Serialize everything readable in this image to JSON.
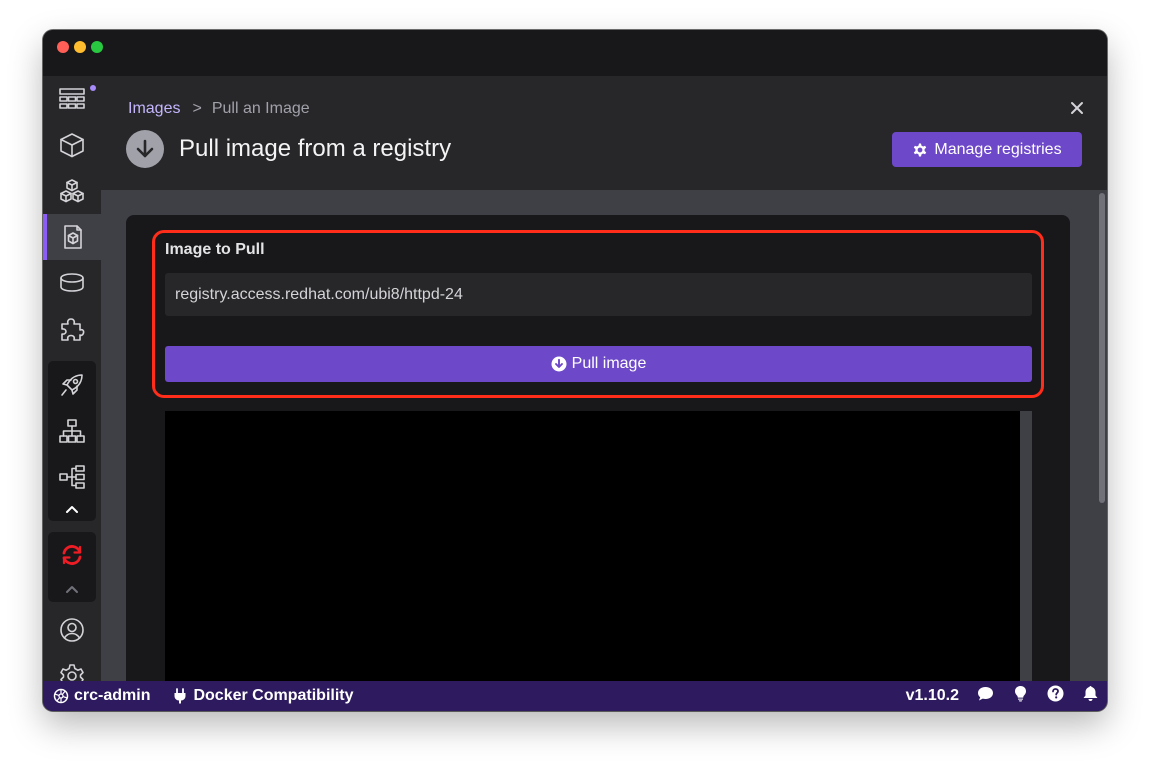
{
  "breadcrumb": {
    "parent": "Images",
    "separator": ">",
    "current": "Pull an Image"
  },
  "header": {
    "title": "Pull image from a registry",
    "manage_label": "Manage registries"
  },
  "form": {
    "section_label": "Image to Pull",
    "image_value": "registry.access.redhat.com/ubi8/httpd-24",
    "pull_label": "Pull image"
  },
  "sidebar": {
    "items": [
      {
        "name": "dashboard",
        "icon": "dashboard-icon",
        "badge": true
      },
      {
        "name": "containers",
        "icon": "cube-icon"
      },
      {
        "name": "pods",
        "icon": "cubes-icon"
      },
      {
        "name": "images",
        "icon": "image-layers-icon",
        "active": true
      },
      {
        "name": "volumes",
        "icon": "database-icon"
      },
      {
        "name": "extensions",
        "icon": "puzzle-icon"
      },
      {
        "name": "deployments",
        "icon": "rocket-icon"
      },
      {
        "name": "services",
        "icon": "sitemap-icon"
      },
      {
        "name": "ingresses",
        "icon": "tree-icon"
      }
    ]
  },
  "statusbar": {
    "context": "crc-admin",
    "compat": "Docker Compatibility",
    "version": "v1.10.2"
  },
  "colors": {
    "accent": "#6d48c9",
    "highlight": "#ff2d1a",
    "statusbar": "#2e1a5e"
  }
}
